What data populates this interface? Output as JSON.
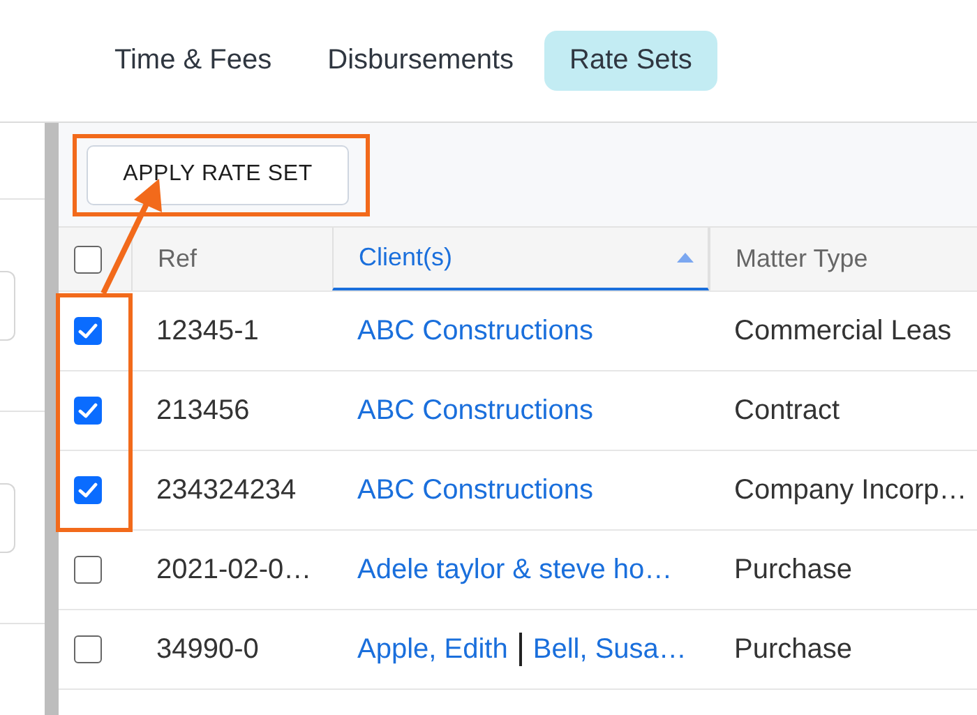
{
  "tabs": [
    {
      "label": "Time & Fees",
      "selected": false
    },
    {
      "label": "Disbursements",
      "selected": false
    },
    {
      "label": "Rate Sets",
      "selected": true
    }
  ],
  "toolbar": {
    "button": "APPLY RATE SET"
  },
  "table": {
    "select_all": {
      "checked": false
    },
    "columns": [
      {
        "label": "Ref",
        "sorted": false
      },
      {
        "label": "Client(s)",
        "sorted": true
      },
      {
        "label": "Matter Type",
        "sorted": false
      }
    ],
    "rows": [
      {
        "checked": true,
        "ref": "12345-1",
        "clients": [
          "ABC Constructions"
        ],
        "matter_type": "Commercial Leas"
      },
      {
        "checked": true,
        "ref": "213456",
        "clients": [
          "ABC Constructions"
        ],
        "matter_type": "Contract"
      },
      {
        "checked": true,
        "ref": "234324234",
        "clients": [
          "ABC Constructions"
        ],
        "matter_type": "Company Incorp…"
      },
      {
        "checked": false,
        "ref": "2021-02-0…",
        "clients": [
          "Adele taylor & steve ho…"
        ],
        "matter_type": "Purchase"
      },
      {
        "checked": false,
        "ref": "34990-0",
        "clients": [
          "Apple, Edith",
          "Bell, Susa…"
        ],
        "matter_type": "Purchase"
      }
    ]
  }
}
